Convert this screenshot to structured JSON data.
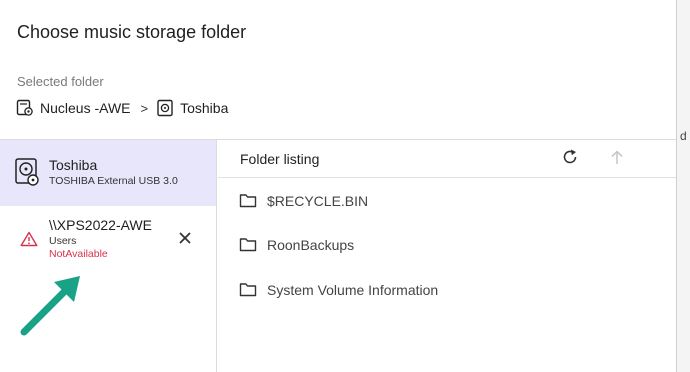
{
  "dialog": {
    "title": "Choose music storage folder",
    "selected_label": "Selected folder"
  },
  "breadcrumb": {
    "items": [
      {
        "label": "Nucleus -AWE",
        "icon": "server-icon"
      },
      {
        "label": "Toshiba",
        "icon": "drive-icon"
      }
    ],
    "separator": ">"
  },
  "sidebar": {
    "items": [
      {
        "name": "Toshiba",
        "subtitle": "TOSHIBA External USB 3.0",
        "icon": "hard-drive-icon",
        "state": "selected"
      },
      {
        "name": "\\\\XPS2022-AWE",
        "subtitle": "Users",
        "status": "NotAvailable",
        "icon": "warning-icon",
        "state": "error"
      }
    ]
  },
  "listing": {
    "title": "Folder listing",
    "folders": [
      "$RECYCLE.BIN",
      "RoonBackups",
      "System Volume Information"
    ]
  },
  "right_strip_char": "d",
  "colors": {
    "selected_bg": "#e7e6fb",
    "error": "#d6334c",
    "annotation_arrow": "#1aa287"
  }
}
